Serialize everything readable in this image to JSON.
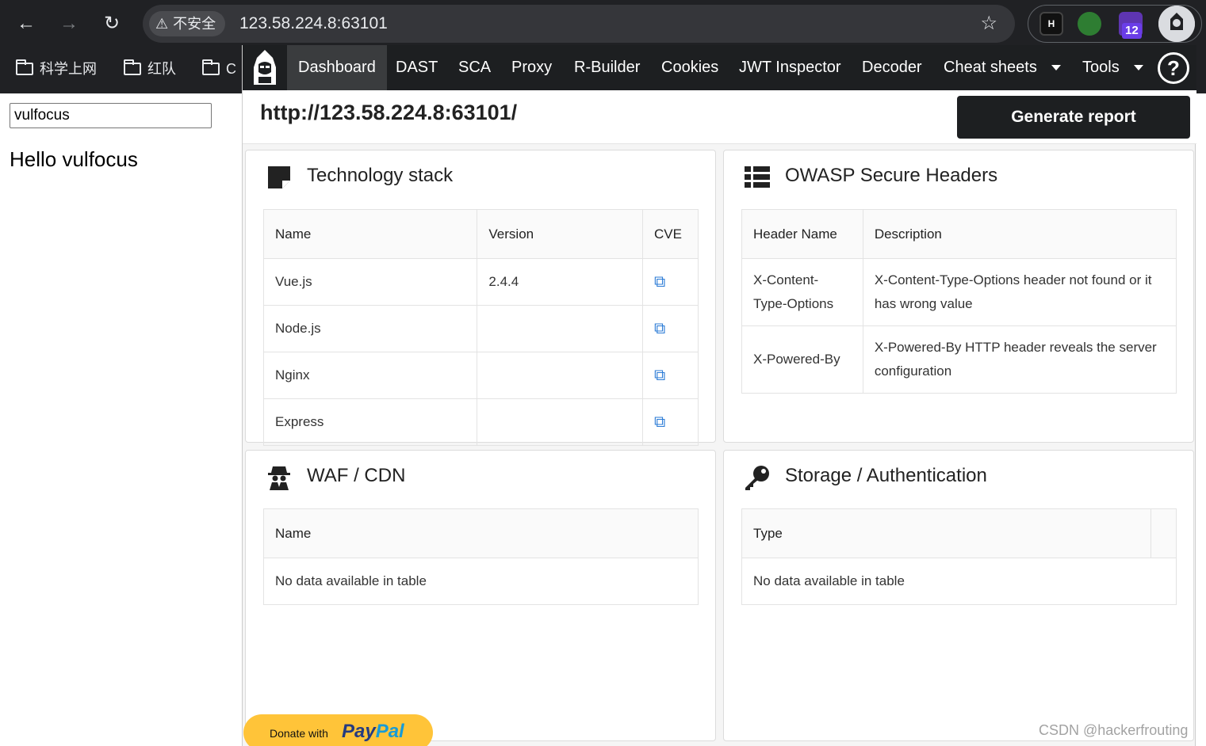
{
  "browser": {
    "security_label": "不安全",
    "url": "123.58.224.8:63101",
    "extension_badge": "12",
    "bookmarks": [
      "科学上网",
      "红队",
      "C"
    ]
  },
  "page": {
    "input_value": "vulfocus",
    "heading": "Hello vulfocus"
  },
  "panel": {
    "nav": {
      "items": [
        "Dashboard",
        "DAST",
        "SCA",
        "Proxy",
        "R-Builder",
        "Cookies",
        "JWT Inspector",
        "Decoder",
        "Cheat sheets",
        "Tools"
      ],
      "active": "Dashboard",
      "help_label": "?"
    },
    "site_url": "http://123.58.224.8:63101/",
    "generate_report": "Generate report",
    "tech_stack": {
      "title": "Technology stack",
      "columns": [
        "Name",
        "Version",
        "CVE"
      ],
      "rows": [
        {
          "name": "Vue.js",
          "version": "2.4.4"
        },
        {
          "name": "Node.js",
          "version": ""
        },
        {
          "name": "Nginx",
          "version": ""
        },
        {
          "name": "Express",
          "version": ""
        }
      ]
    },
    "owasp": {
      "title": "OWASP Secure Headers",
      "columns": [
        "Header Name",
        "Description"
      ],
      "rows": [
        {
          "header": "X-Content-Type-Options",
          "description": "X-Content-Type-Options header not found or it has wrong value"
        },
        {
          "header": "X-Powered-By",
          "description": "X-Powered-By HTTP header reveals the server configuration"
        }
      ]
    },
    "waf": {
      "title": "WAF / CDN",
      "columns": [
        "Name"
      ],
      "empty": "No data available in table"
    },
    "storage": {
      "title": "Storage / Authentication",
      "columns": [
        "Type"
      ],
      "empty": "No data available in table"
    },
    "donate": {
      "prefix": "Donate with",
      "brand_pay": "Pay",
      "brand_pal": "Pal"
    }
  },
  "watermark": "CSDN @hackerfrouting"
}
